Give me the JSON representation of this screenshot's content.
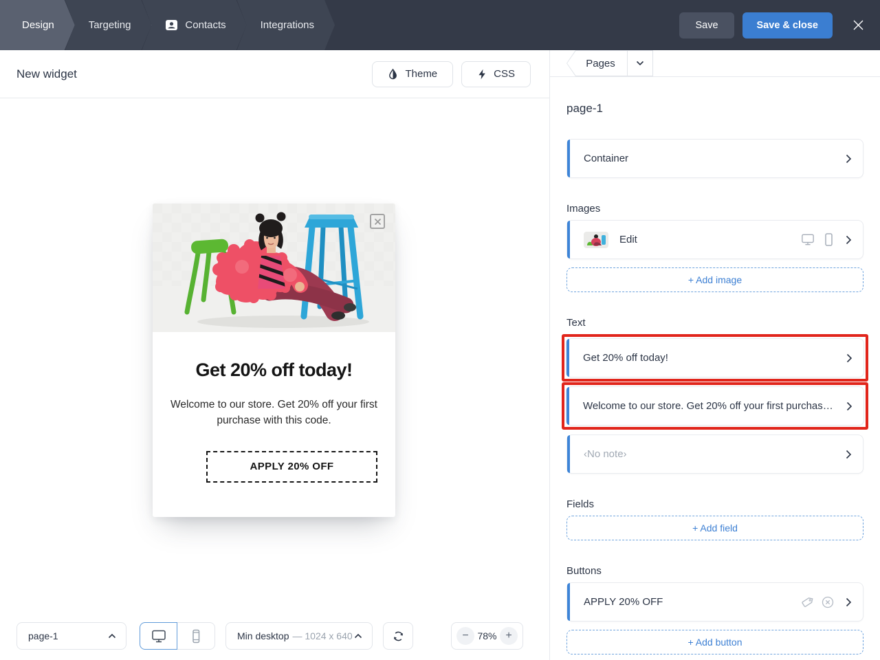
{
  "topbar": {
    "tabs": [
      "Design",
      "Targeting",
      "Contacts",
      "Integrations"
    ],
    "save_label": "Save",
    "save_close_label": "Save & close"
  },
  "header": {
    "title": "New widget",
    "theme_label": "Theme",
    "css_label": "CSS",
    "pages_label": "Pages"
  },
  "panel": {
    "page_title": "page-1",
    "container_label": "Container",
    "images_section": "Images",
    "image_edit_label": "Edit",
    "add_image_label": "+ Add image",
    "text_section": "Text",
    "text_items": [
      "Get 20% off today!",
      "Welcome to our store. Get 20% off your first purchase ...",
      "‹No note›"
    ],
    "fields_section": "Fields",
    "add_field_label": "+ Add field",
    "buttons_section": "Buttons",
    "button_item_label": "APPLY 20% OFF",
    "add_button_label": "+ Add button"
  },
  "preview": {
    "headline": "Get 20% off today!",
    "body": "Welcome to our store. Get 20% off your first purchase with this code.",
    "button_label": "APPLY 20% OFF"
  },
  "toolbar": {
    "page_select": "page-1",
    "size_label": "Min desktop",
    "size_detail": "— 1024 x 640",
    "zoom_value": "78%",
    "zoom_out_label": "−",
    "zoom_in_label": "+"
  },
  "colors": {
    "accent_blue": "#3d84d7",
    "highlight_red": "#e1251b",
    "topbar_bg": "#343a48"
  }
}
